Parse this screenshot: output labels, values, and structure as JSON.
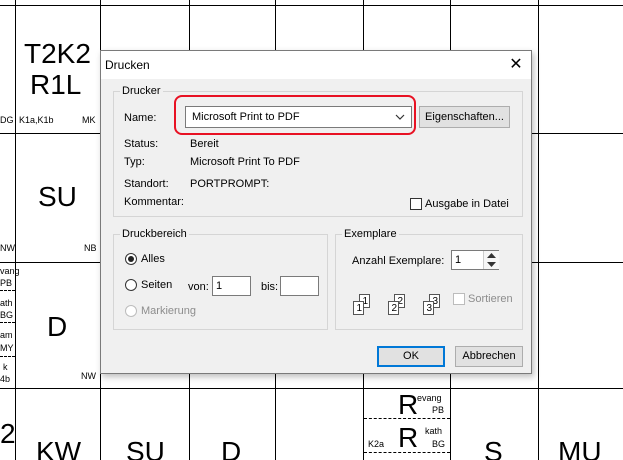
{
  "background": {
    "cells": {
      "t2k2": "T2K2",
      "r1l": "R1L",
      "dg": "DG",
      "k1a_k1b": "K1a,K1b",
      "mk": "MK",
      "su_1": "SU",
      "nw_1": "NW",
      "nb": "NB",
      "vang": "vang",
      "pb_1": "PB",
      "ath": "ath",
      "bg_1": "BG",
      "am": "am",
      "my": "MY",
      "k_1": "k",
      "b4b": "4b",
      "d_1": "D",
      "nw_2": "NW",
      "num_2": "2",
      "kw": "KW",
      "su_2": "SU",
      "d_2": "D",
      "r_1": "R",
      "evang": "evang",
      "pb_2": "PB",
      "k2a": "K2a",
      "r_2": "R",
      "kath": "kath",
      "bg_2": "BG",
      "s": "S",
      "mu": "MU"
    }
  },
  "dialog": {
    "title": "Drucken",
    "close_glyph": "✕",
    "printer_group": {
      "legend": "Drucker",
      "name_label": "Name:",
      "name_value": "Microsoft Print to PDF",
      "properties_button": "Eigenschaften...",
      "status_label": "Status:",
      "status_value": "Bereit",
      "type_label": "Typ:",
      "type_value": "Microsoft Print To PDF",
      "location_label": "Standort:",
      "location_value": "PORTPROMPT:",
      "comment_label": "Kommentar:",
      "print_to_file_label": "Ausgabe in Datei",
      "print_to_file_checked": false,
      "highlight_color": "#e81123"
    },
    "range_group": {
      "legend": "Druckbereich",
      "all_label": "Alles",
      "pages_label": "Seiten",
      "from_label": "von:",
      "from_value": "1",
      "to_label": "bis:",
      "to_value": "",
      "selection_label": "Markierung",
      "selected": "all"
    },
    "copies_group": {
      "legend": "Exemplare",
      "count_label": "Anzahl Exemplare:",
      "count_value": "1",
      "collate_label": "Sortieren",
      "collate_checked": false,
      "page_numbers": [
        "1",
        "1",
        "2",
        "2",
        "3",
        "3"
      ]
    },
    "ok_button": "OK",
    "cancel_button": "Abbrechen",
    "accent_color": "#0078d7"
  }
}
